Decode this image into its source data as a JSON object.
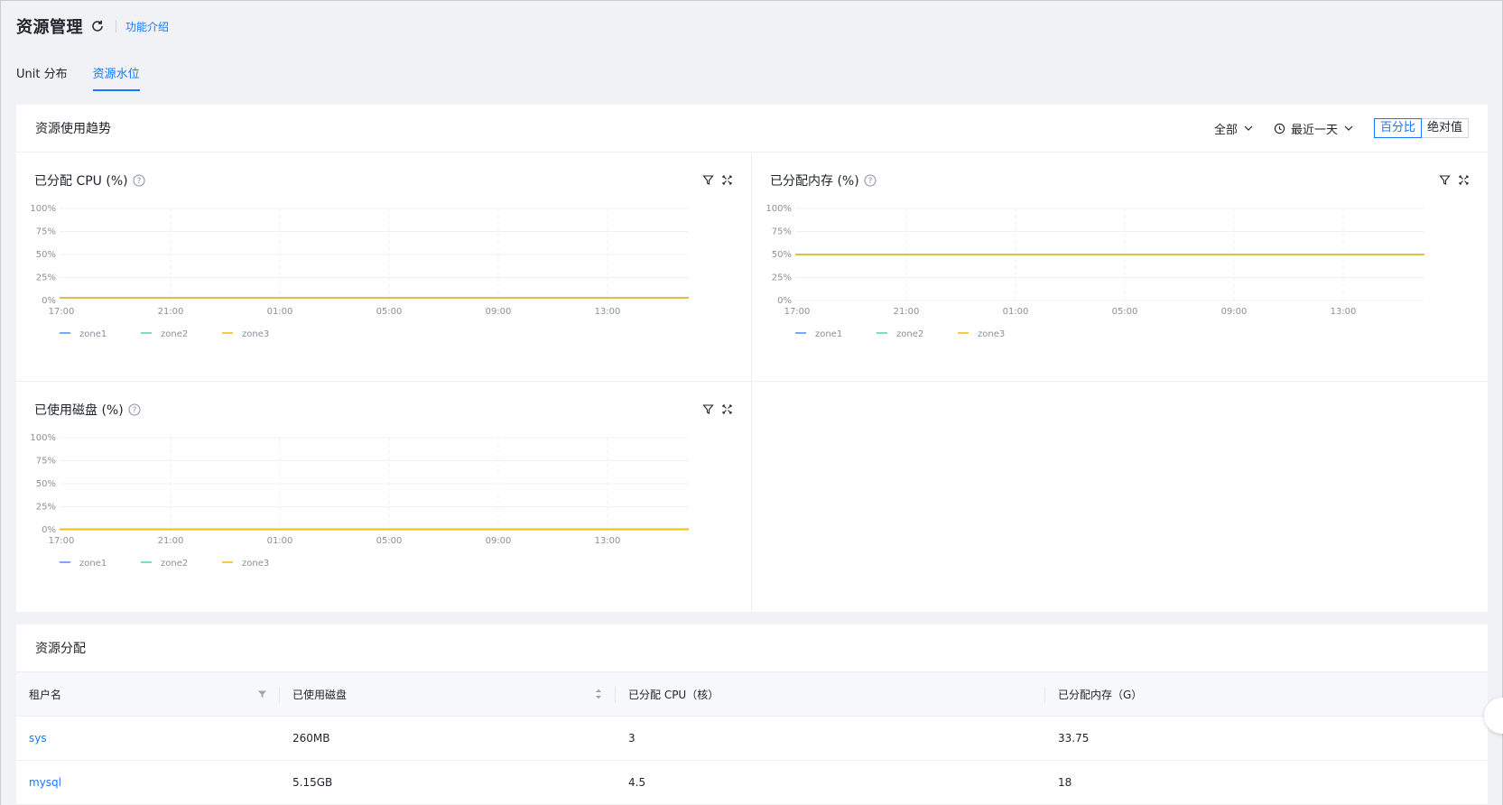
{
  "header": {
    "title": "资源管理",
    "intro_link": "功能介绍"
  },
  "tabs": [
    {
      "label": "Unit 分布",
      "active": false
    },
    {
      "label": "资源水位",
      "active": true
    }
  ],
  "trend": {
    "title": "资源使用趋势",
    "scope_select": "全部",
    "range_select": "最近一天",
    "mode_percent": "百分比",
    "mode_absolute": "绝对值"
  },
  "colors": {
    "accent": "#1677ff",
    "zone1": "#5b8ff9",
    "zone2": "#5ad8a6",
    "zone3": "#f6bd16"
  },
  "chart_data": [
    {
      "type": "line",
      "title": "已分配 CPU (%)",
      "x": [
        "17:00",
        "21:00",
        "01:00",
        "05:00",
        "09:00",
        "13:00"
      ],
      "y_ticks": [
        "100%",
        "75%",
        "50%",
        "25%",
        "0%"
      ],
      "ylim": [
        0,
        100
      ],
      "grid": true,
      "legend": "bottom-left",
      "series": [
        {
          "name": "zone1",
          "values": [
            3,
            3,
            3,
            3,
            3,
            3,
            3
          ]
        },
        {
          "name": "zone2",
          "values": [
            3,
            3,
            3,
            3,
            3,
            3,
            3
          ]
        },
        {
          "name": "zone3",
          "values": [
            3,
            3,
            3,
            3,
            3,
            3,
            3
          ]
        }
      ]
    },
    {
      "type": "line",
      "title": "已分配内存 (%)",
      "x": [
        "17:00",
        "21:00",
        "01:00",
        "05:00",
        "09:00",
        "13:00"
      ],
      "y_ticks": [
        "100%",
        "75%",
        "50%",
        "25%",
        "0%"
      ],
      "ylim": [
        0,
        100
      ],
      "grid": true,
      "legend": "bottom-left",
      "series": [
        {
          "name": "zone1",
          "values": [
            50,
            50,
            50,
            50,
            50,
            50,
            50
          ]
        },
        {
          "name": "zone2",
          "values": [
            50,
            50,
            50,
            50,
            50,
            50,
            50
          ]
        },
        {
          "name": "zone3",
          "values": [
            50,
            50,
            50,
            50,
            50,
            50,
            50
          ]
        }
      ]
    },
    {
      "type": "line",
      "title": "已使用磁盘 (%)",
      "x": [
        "17:00",
        "21:00",
        "01:00",
        "05:00",
        "09:00",
        "13:00"
      ],
      "y_ticks": [
        "100%",
        "75%",
        "50%",
        "25%",
        "0%"
      ],
      "ylim": [
        0,
        100
      ],
      "grid": true,
      "legend": "bottom-left",
      "series": [
        {
          "name": "zone1",
          "values": [
            0.5,
            0.5,
            0.5,
            0.5,
            0.5,
            0.5,
            0.5
          ]
        },
        {
          "name": "zone2",
          "values": [
            0.5,
            0.5,
            0.5,
            0.5,
            0.5,
            0.5,
            0.5
          ]
        },
        {
          "name": "zone3",
          "values": [
            0.5,
            0.5,
            0.5,
            0.5,
            0.5,
            0.5,
            0.5
          ]
        }
      ]
    }
  ],
  "allocation": {
    "title": "资源分配",
    "columns": [
      "租户名",
      "已使用磁盘",
      "已分配 CPU（核）",
      "已分配内存（G）"
    ],
    "rows": [
      [
        "sys",
        "260MB",
        "3",
        "33.75"
      ],
      [
        "mysql",
        "5.15GB",
        "4.5",
        "18"
      ]
    ]
  }
}
